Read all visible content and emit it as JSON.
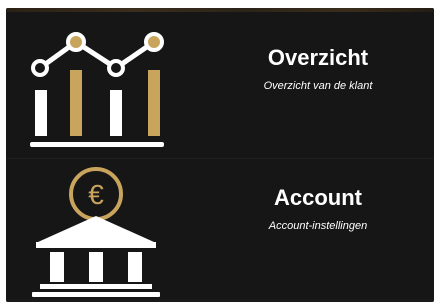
{
  "colors": {
    "panel": "#161616",
    "gold": "#c9a45c",
    "white": "#ffffff"
  },
  "menu": {
    "items": [
      {
        "title": "Overzicht",
        "subtitle": "Overzicht van de klant",
        "icon": "bar-chart-trend-icon"
      },
      {
        "title": "Account",
        "subtitle": "Account-instellingen",
        "icon": "bank-euro-icon"
      }
    ]
  },
  "account_icon": {
    "coin_symbol": "€"
  }
}
